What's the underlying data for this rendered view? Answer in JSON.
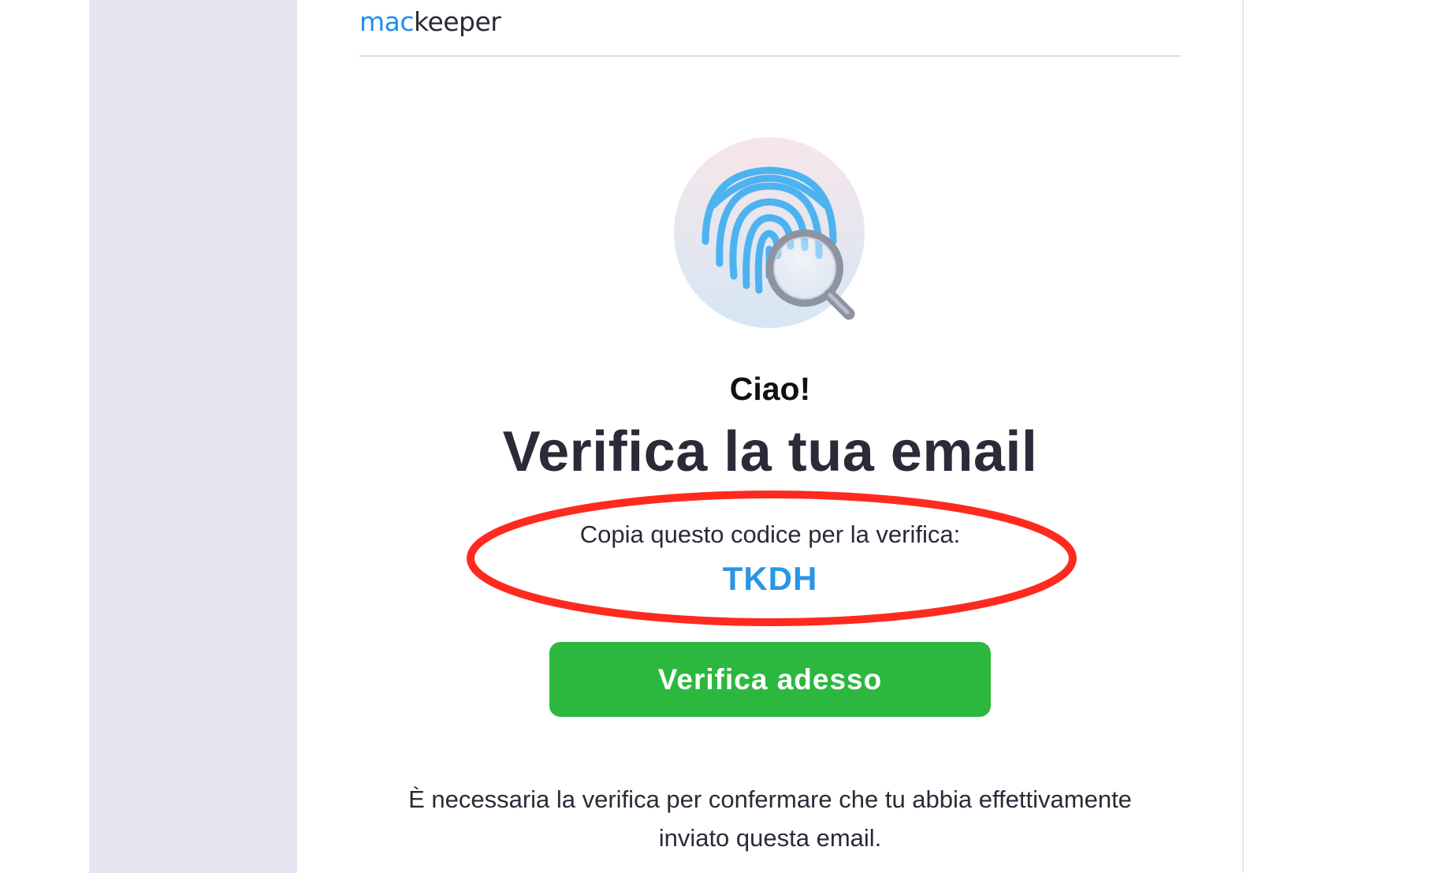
{
  "brand": {
    "logo_prefix": "mac",
    "logo_suffix": "keeper"
  },
  "hero": {
    "icon": "fingerprint-magnifier-icon"
  },
  "content": {
    "greeting": "Ciao!",
    "headline": "Verifica la tua email",
    "code_label": "Copia questo codice per la verifica:",
    "code": "TKDH",
    "button_label": "Verifica adesso",
    "footnote": "È necessaria la verifica per confermare che tu abbia effettivamente inviato questa email."
  },
  "colors": {
    "page_background": "#e5e6f2",
    "brand_blue": "#1f8ef1",
    "code_blue": "#2a95e6",
    "button_green": "#2cb83e",
    "annotation_red": "#ff2a1f",
    "text_dark": "#2a2b38"
  }
}
